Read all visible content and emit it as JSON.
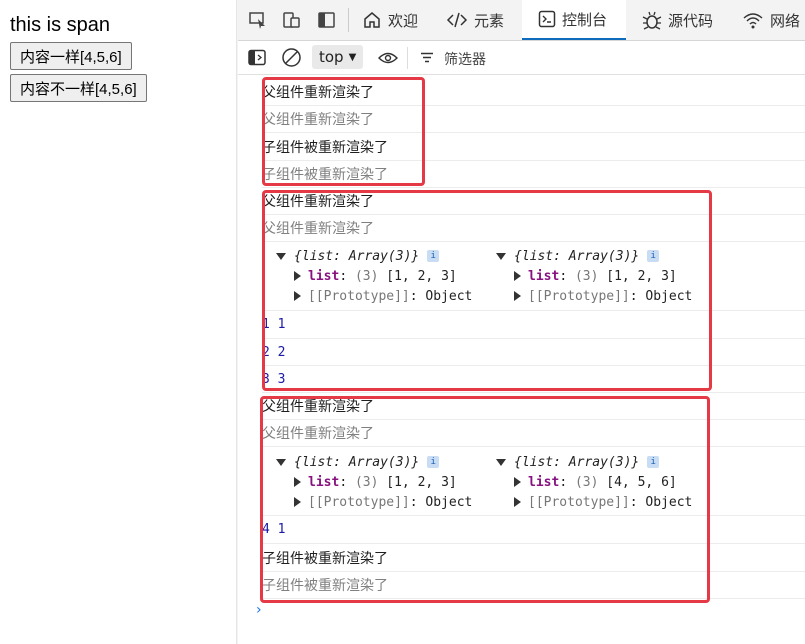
{
  "preview": {
    "span_text": "this is span",
    "button_same": "内容一样[4,5,6]",
    "button_diff": "内容不一样[4,5,6]"
  },
  "tabs": [
    {
      "label": "欢迎",
      "icon": "home-icon"
    },
    {
      "label": "元素",
      "icon": "code-icon"
    },
    {
      "label": "控制台",
      "icon": "console-icon",
      "active": true
    },
    {
      "label": "源代码",
      "icon": "bug-icon"
    },
    {
      "label": "网络",
      "icon": "wifi-icon"
    }
  ],
  "filterbar": {
    "context": "top",
    "filter_label": "筛选器"
  },
  "console": {
    "group1": [
      "父组件重新渲染了",
      "父组件重新渲染了",
      "子组件被重新渲染了",
      "子组件被重新渲染了"
    ],
    "group2": {
      "lines": [
        "父组件重新渲染了",
        "父组件重新渲染了"
      ],
      "objects": [
        {
          "head": "{list: Array(3)}",
          "list_key": "list",
          "list_count": "(3)",
          "list_value": "[1, 2, 3]",
          "proto_key": "[[Prototype]]",
          "proto_value": "Object"
        },
        {
          "head": "{list: Array(3)}",
          "list_key": "list",
          "list_count": "(3)",
          "list_value": "[1, 2, 3]",
          "proto_key": "[[Prototype]]",
          "proto_value": "Object"
        }
      ],
      "numbers": [
        "1 1",
        "2 2",
        "3 3"
      ]
    },
    "group3": {
      "lines": [
        "父组件重新渲染了",
        "父组件重新渲染了"
      ],
      "objects": [
        {
          "head": "{list: Array(3)}",
          "list_key": "list",
          "list_count": "(3)",
          "list_value": "[1, 2, 3]",
          "proto_key": "[[Prototype]]",
          "proto_value": "Object"
        },
        {
          "head": "{list: Array(3)}",
          "list_key": "list",
          "list_count": "(3)",
          "list_value": "[4, 5, 6]",
          "proto_key": "[[Prototype]]",
          "proto_value": "Object"
        }
      ],
      "number": "4 1",
      "tail": [
        "子组件被重新渲染了",
        "子组件被重新渲染了"
      ]
    },
    "prompt": "›"
  },
  "colors": {
    "highlight": "#e63946",
    "accent": "#0f6cbd"
  }
}
